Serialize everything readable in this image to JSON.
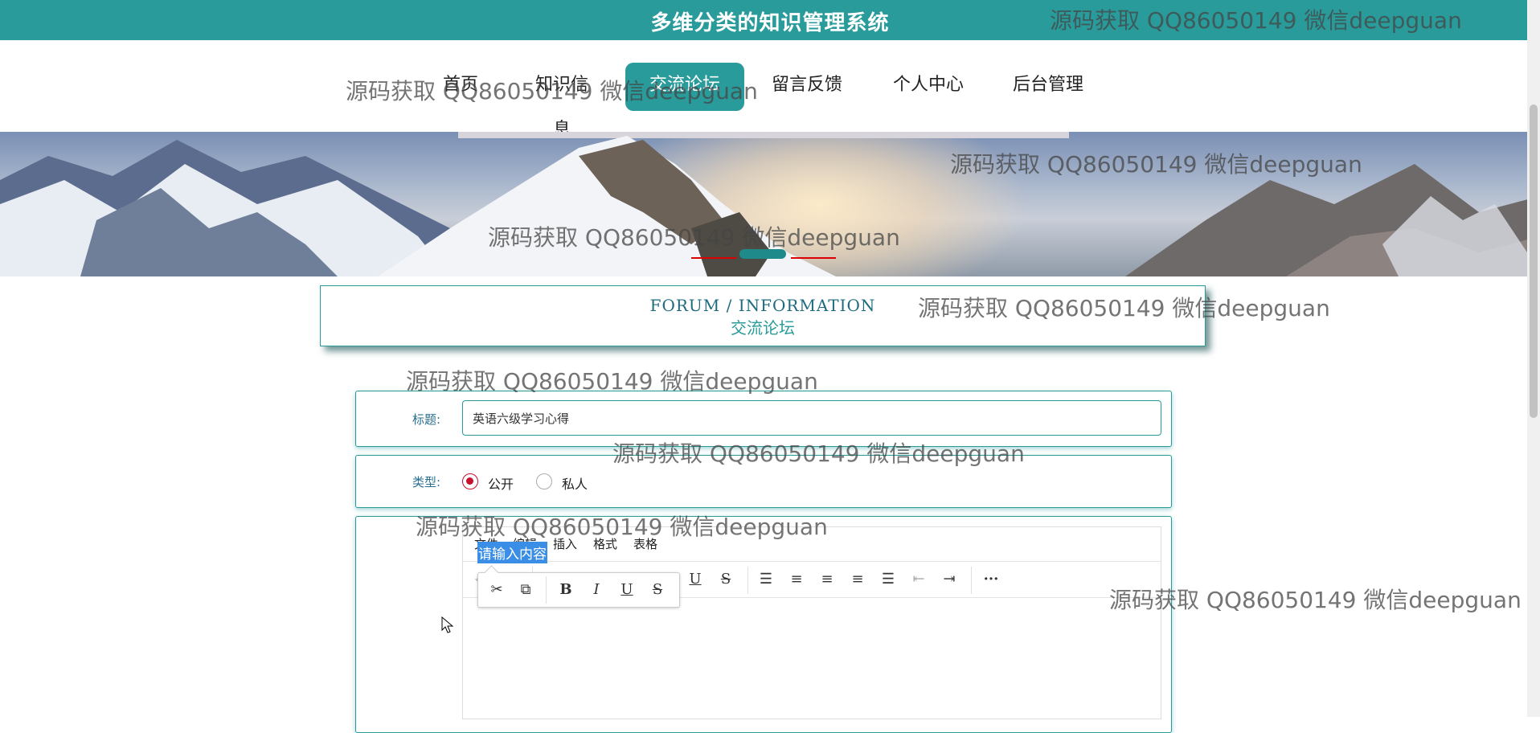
{
  "header": {
    "title": "多维分类的知识管理系统"
  },
  "nav": {
    "items": [
      {
        "label": "首页"
      },
      {
        "label": "知识信息"
      },
      {
        "label": "交流论坛"
      },
      {
        "label": "留言反馈"
      },
      {
        "label": "个人中心"
      },
      {
        "label": "后台管理"
      }
    ],
    "active": "交流论坛"
  },
  "section": {
    "title_en": "FORUM / INFORMATION",
    "title_cn": "交流论坛"
  },
  "form": {
    "title_label": "标题:",
    "title_value": "英语六级学习心得",
    "type_label": "类型:",
    "type_options": [
      "公开",
      "私人"
    ],
    "type_selected": "公开"
  },
  "editor": {
    "menu": [
      "文件",
      "编辑",
      "插入",
      "格式",
      "表格"
    ],
    "content": "请输入内容",
    "toolbar_icons": [
      "undo-icon",
      "redo-icon",
      "text-color-icon",
      "highlight-color-icon",
      "bold-icon",
      "italic-icon",
      "underline-icon",
      "strikethrough-icon",
      "line-height-icon",
      "align-left-icon",
      "align-center-icon",
      "align-right-icon",
      "align-justify-icon",
      "outdent-icon",
      "indent-icon",
      "more-icon"
    ],
    "quickbar_icons": [
      "cut-icon",
      "copy-icon",
      "bold-icon",
      "italic-icon",
      "underline-icon",
      "strikethrough-icon"
    ]
  },
  "watermark": "源码获取 QQ86050149 微信deepguan",
  "colors": {
    "primary": "#2a9b9b",
    "selection": "#3a8ee6",
    "radio_active": "#c8102e"
  }
}
